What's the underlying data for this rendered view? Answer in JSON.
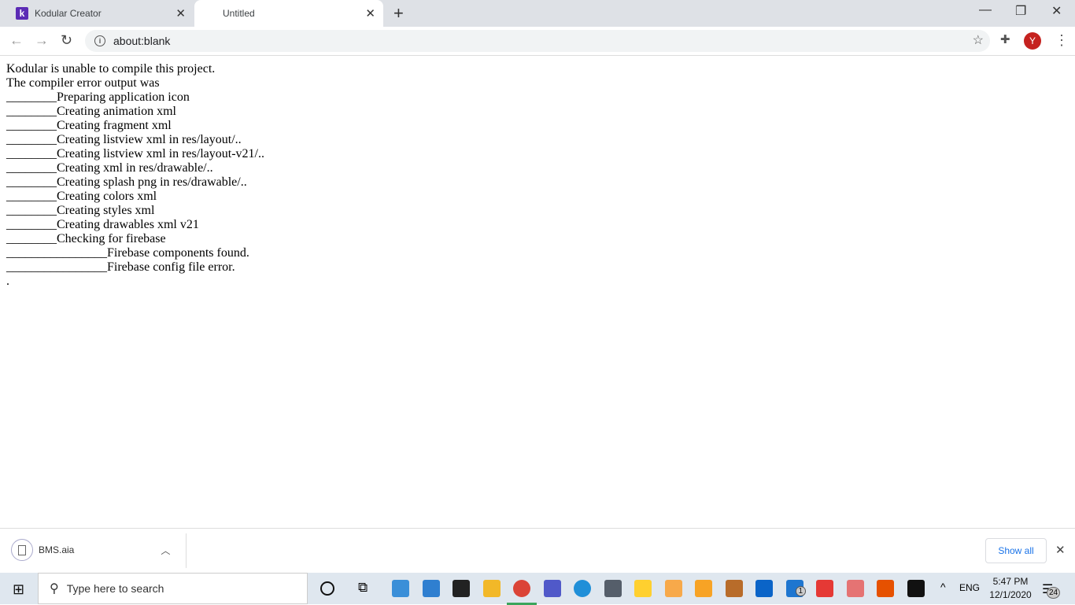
{
  "browser": {
    "tabs": [
      {
        "title": "Kodular Creator",
        "favicon": "k"
      },
      {
        "title": "Untitled"
      }
    ],
    "url": "about:blank",
    "profile_initial": "Y"
  },
  "content": {
    "lines": [
      "Kodular is unable to compile this project.",
      "The compiler error output was",
      "________Preparing application icon",
      "________Creating animation xml",
      "________Creating fragment xml",
      "________Creating listview xml in res/layout/..",
      "________Creating listview xml in res/layout-v21/..",
      "________Creating xml in res/drawable/..",
      "________Creating splash png in res/drawable/..",
      "________Creating colors xml",
      "________Creating styles xml",
      "________Creating drawables xml v21",
      "________Checking for firebase",
      "________________Firebase components found.",
      "________________Firebase config file error.",
      "."
    ]
  },
  "downloads": {
    "file": "BMS.aia",
    "show_all": "Show all"
  },
  "taskbar": {
    "search_placeholder": "Type here to search",
    "lang": "ENG",
    "time": "5:47 PM",
    "date": "12/1/2020",
    "mail_badge": "1",
    "notif_count": "24",
    "apps": [
      {
        "name": "file-explorer",
        "color": "#3a8fd8"
      },
      {
        "name": "control-panel",
        "color": "#2f7fd0"
      },
      {
        "name": "store",
        "color": "#222222"
      },
      {
        "name": "folder",
        "color": "#f2b828"
      },
      {
        "name": "chrome",
        "color": "#db4437"
      },
      {
        "name": "teams",
        "color": "#5059c9"
      },
      {
        "name": "edge",
        "color": "#1f8fd8"
      },
      {
        "name": "calculator",
        "color": "#555e6a"
      },
      {
        "name": "miro",
        "color": "#ffd02f"
      },
      {
        "name": "scratch",
        "color": "#f7a94a"
      },
      {
        "name": "app-orange",
        "color": "#f7a325"
      },
      {
        "name": "app-face",
        "color": "#b86c2a"
      },
      {
        "name": "outlook",
        "color": "#0a64c8"
      },
      {
        "name": "mail",
        "color": "#1e76d0"
      },
      {
        "name": "app-red",
        "color": "#e53935"
      },
      {
        "name": "snip",
        "color": "#e57373"
      },
      {
        "name": "paint",
        "color": "#e65100"
      },
      {
        "name": "terminal",
        "color": "#111111"
      }
    ]
  }
}
